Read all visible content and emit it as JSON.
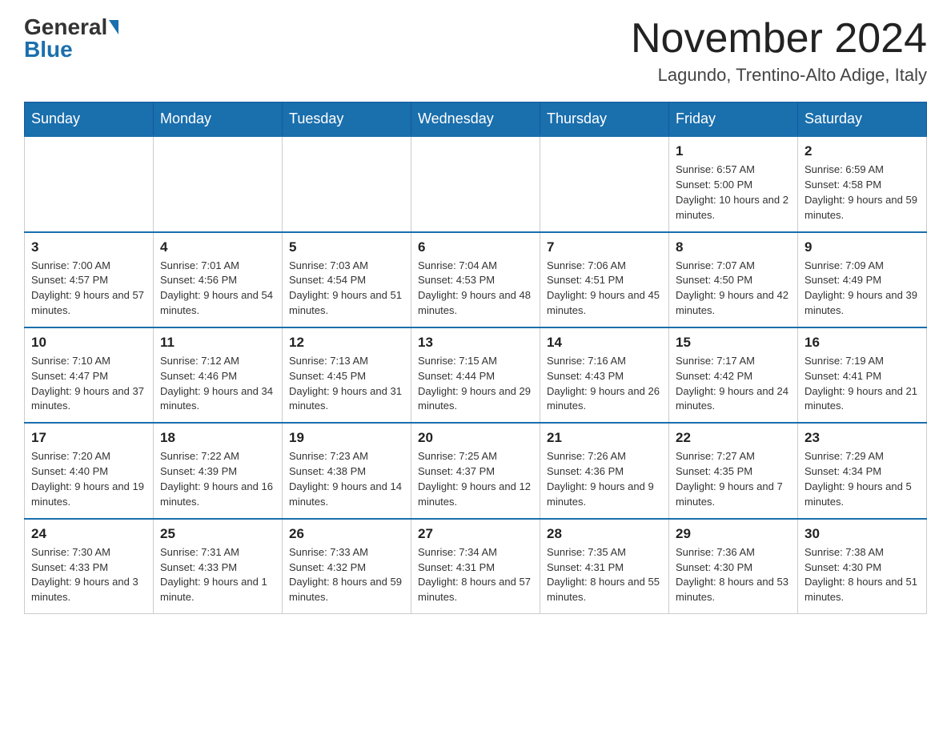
{
  "header": {
    "logo_general": "General",
    "logo_blue": "Blue",
    "month_year": "November 2024",
    "location": "Lagundo, Trentino-Alto Adige, Italy"
  },
  "days_of_week": [
    "Sunday",
    "Monday",
    "Tuesday",
    "Wednesday",
    "Thursday",
    "Friday",
    "Saturday"
  ],
  "weeks": [
    [
      {
        "day": "",
        "info": ""
      },
      {
        "day": "",
        "info": ""
      },
      {
        "day": "",
        "info": ""
      },
      {
        "day": "",
        "info": ""
      },
      {
        "day": "",
        "info": ""
      },
      {
        "day": "1",
        "info": "Sunrise: 6:57 AM\nSunset: 5:00 PM\nDaylight: 10 hours and 2 minutes."
      },
      {
        "day": "2",
        "info": "Sunrise: 6:59 AM\nSunset: 4:58 PM\nDaylight: 9 hours and 59 minutes."
      }
    ],
    [
      {
        "day": "3",
        "info": "Sunrise: 7:00 AM\nSunset: 4:57 PM\nDaylight: 9 hours and 57 minutes."
      },
      {
        "day": "4",
        "info": "Sunrise: 7:01 AM\nSunset: 4:56 PM\nDaylight: 9 hours and 54 minutes."
      },
      {
        "day": "5",
        "info": "Sunrise: 7:03 AM\nSunset: 4:54 PM\nDaylight: 9 hours and 51 minutes."
      },
      {
        "day": "6",
        "info": "Sunrise: 7:04 AM\nSunset: 4:53 PM\nDaylight: 9 hours and 48 minutes."
      },
      {
        "day": "7",
        "info": "Sunrise: 7:06 AM\nSunset: 4:51 PM\nDaylight: 9 hours and 45 minutes."
      },
      {
        "day": "8",
        "info": "Sunrise: 7:07 AM\nSunset: 4:50 PM\nDaylight: 9 hours and 42 minutes."
      },
      {
        "day": "9",
        "info": "Sunrise: 7:09 AM\nSunset: 4:49 PM\nDaylight: 9 hours and 39 minutes."
      }
    ],
    [
      {
        "day": "10",
        "info": "Sunrise: 7:10 AM\nSunset: 4:47 PM\nDaylight: 9 hours and 37 minutes."
      },
      {
        "day": "11",
        "info": "Sunrise: 7:12 AM\nSunset: 4:46 PM\nDaylight: 9 hours and 34 minutes."
      },
      {
        "day": "12",
        "info": "Sunrise: 7:13 AM\nSunset: 4:45 PM\nDaylight: 9 hours and 31 minutes."
      },
      {
        "day": "13",
        "info": "Sunrise: 7:15 AM\nSunset: 4:44 PM\nDaylight: 9 hours and 29 minutes."
      },
      {
        "day": "14",
        "info": "Sunrise: 7:16 AM\nSunset: 4:43 PM\nDaylight: 9 hours and 26 minutes."
      },
      {
        "day": "15",
        "info": "Sunrise: 7:17 AM\nSunset: 4:42 PM\nDaylight: 9 hours and 24 minutes."
      },
      {
        "day": "16",
        "info": "Sunrise: 7:19 AM\nSunset: 4:41 PM\nDaylight: 9 hours and 21 minutes."
      }
    ],
    [
      {
        "day": "17",
        "info": "Sunrise: 7:20 AM\nSunset: 4:40 PM\nDaylight: 9 hours and 19 minutes."
      },
      {
        "day": "18",
        "info": "Sunrise: 7:22 AM\nSunset: 4:39 PM\nDaylight: 9 hours and 16 minutes."
      },
      {
        "day": "19",
        "info": "Sunrise: 7:23 AM\nSunset: 4:38 PM\nDaylight: 9 hours and 14 minutes."
      },
      {
        "day": "20",
        "info": "Sunrise: 7:25 AM\nSunset: 4:37 PM\nDaylight: 9 hours and 12 minutes."
      },
      {
        "day": "21",
        "info": "Sunrise: 7:26 AM\nSunset: 4:36 PM\nDaylight: 9 hours and 9 minutes."
      },
      {
        "day": "22",
        "info": "Sunrise: 7:27 AM\nSunset: 4:35 PM\nDaylight: 9 hours and 7 minutes."
      },
      {
        "day": "23",
        "info": "Sunrise: 7:29 AM\nSunset: 4:34 PM\nDaylight: 9 hours and 5 minutes."
      }
    ],
    [
      {
        "day": "24",
        "info": "Sunrise: 7:30 AM\nSunset: 4:33 PM\nDaylight: 9 hours and 3 minutes."
      },
      {
        "day": "25",
        "info": "Sunrise: 7:31 AM\nSunset: 4:33 PM\nDaylight: 9 hours and 1 minute."
      },
      {
        "day": "26",
        "info": "Sunrise: 7:33 AM\nSunset: 4:32 PM\nDaylight: 8 hours and 59 minutes."
      },
      {
        "day": "27",
        "info": "Sunrise: 7:34 AM\nSunset: 4:31 PM\nDaylight: 8 hours and 57 minutes."
      },
      {
        "day": "28",
        "info": "Sunrise: 7:35 AM\nSunset: 4:31 PM\nDaylight: 8 hours and 55 minutes."
      },
      {
        "day": "29",
        "info": "Sunrise: 7:36 AM\nSunset: 4:30 PM\nDaylight: 8 hours and 53 minutes."
      },
      {
        "day": "30",
        "info": "Sunrise: 7:38 AM\nSunset: 4:30 PM\nDaylight: 8 hours and 51 minutes."
      }
    ]
  ]
}
